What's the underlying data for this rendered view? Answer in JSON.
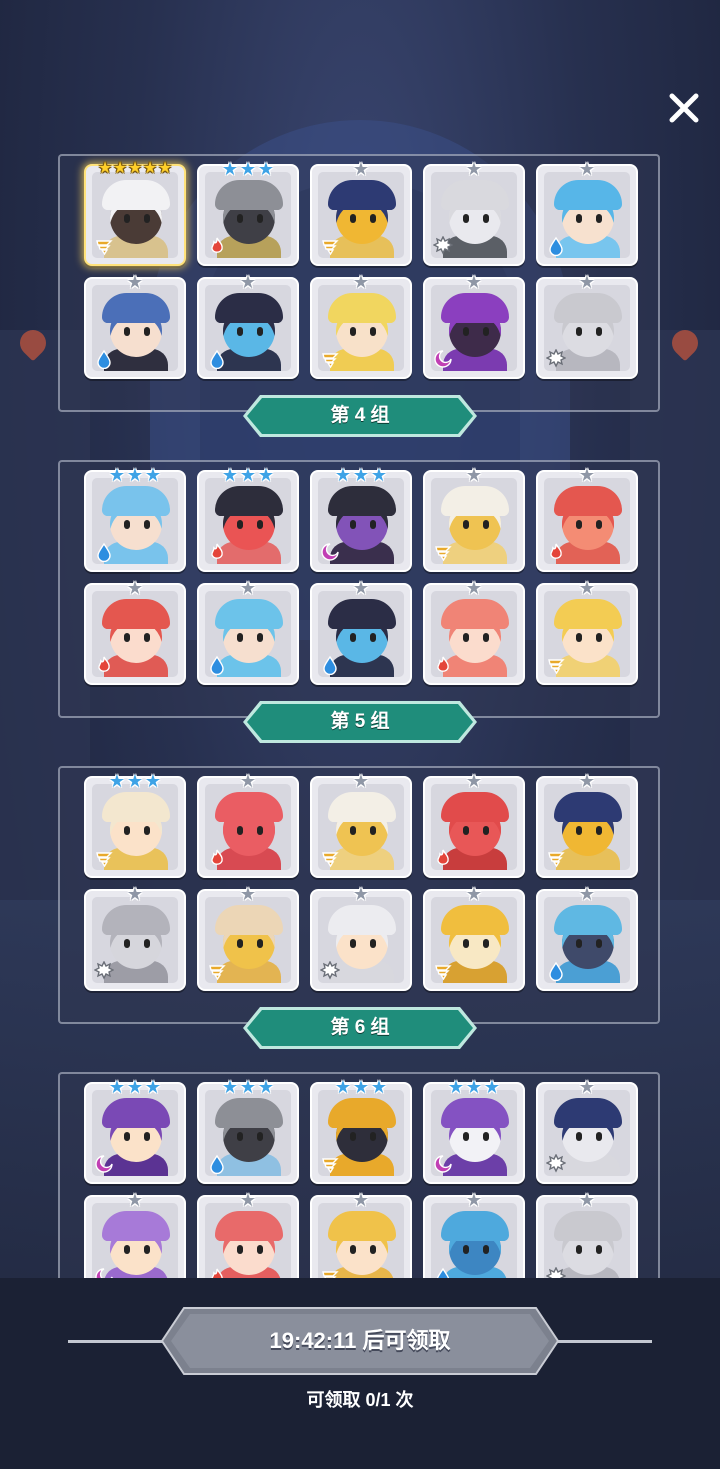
{
  "colors": {
    "banner_fill": "#1f8d7b",
    "banner_border": "#bfe8df",
    "star_grey": "#8f97a6",
    "star_blue": "#3ea3e6",
    "star_gold": "#ffcf2a"
  },
  "groups": [
    {
      "label": "",
      "cards": [
        {
          "stars": 5,
          "star_color": "gold",
          "element": "wind",
          "hair": "#f2f2f4",
          "skin": "#4a3b36",
          "body": "#d8c28e",
          "highlight": true
        },
        {
          "stars": 3,
          "star_color": "blue",
          "element": "fire",
          "hair": "#8d8f96",
          "skin": "#3f3f46",
          "body": "#b7a15b"
        },
        {
          "stars": 1,
          "star_color": "grey",
          "element": "wind",
          "hair": "#2d3a73",
          "skin": "#f0b733",
          "body": "#e7c05a"
        },
        {
          "stars": 1,
          "star_color": "grey",
          "element": "light",
          "hair": "#d9d9de",
          "skin": "#e9e9ee",
          "body": "#5b5f66"
        },
        {
          "stars": 1,
          "star_color": "grey",
          "element": "water",
          "hair": "#57b6e8",
          "skin": "#f7e1cf",
          "body": "#78c5ee"
        },
        {
          "stars": 1,
          "star_color": "grey",
          "element": "water",
          "hair": "#4b6fb8",
          "skin": "#f6dfcf",
          "body": "#2f2f3f"
        },
        {
          "stars": 1,
          "star_color": "grey",
          "element": "water",
          "hair": "#2b2d46",
          "skin": "#5ab7e6",
          "body": "#2d3550"
        },
        {
          "stars": 1,
          "star_color": "grey",
          "element": "wind",
          "hair": "#f1d65f",
          "skin": "#f8e1c9",
          "body": "#f0cc53"
        },
        {
          "stars": 1,
          "star_color": "grey",
          "element": "dark",
          "hair": "#8b3fbf",
          "skin": "#3e2b4a",
          "body": "#7b3bb0"
        },
        {
          "stars": 1,
          "star_color": "grey",
          "element": "light",
          "hair": "#c9c9cf",
          "skin": "#dcdce2",
          "body": "#b7b7bf"
        }
      ]
    },
    {
      "label": "第 4 组",
      "cards": [
        {
          "stars": 3,
          "star_color": "blue",
          "element": "water",
          "hair": "#79c3ec",
          "skin": "#f6dfcf",
          "body": "#79c3ec"
        },
        {
          "stars": 3,
          "star_color": "blue",
          "element": "fire",
          "hair": "#2d2d3b",
          "skin": "#ea5454",
          "body": "#e36c6c"
        },
        {
          "stars": 3,
          "star_color": "blue",
          "element": "dark",
          "hair": "#2d2d3b",
          "skin": "#8253b8",
          "body": "#3a2f4d"
        },
        {
          "stars": 1,
          "star_color": "grey",
          "element": "wind",
          "hair": "#f3efe6",
          "skin": "#efc352",
          "body": "#eed07f"
        },
        {
          "stars": 1,
          "star_color": "grey",
          "element": "fire",
          "hair": "#e4574f",
          "skin": "#f48c74",
          "body": "#e26256"
        },
        {
          "stars": 1,
          "star_color": "grey",
          "element": "fire",
          "hair": "#e4574f",
          "skin": "#fbdccd",
          "body": "#e05b55"
        },
        {
          "stars": 1,
          "star_color": "grey",
          "element": "water",
          "hair": "#6cc3ea",
          "skin": "#f6dfcf",
          "body": "#6cc3ea"
        },
        {
          "stars": 1,
          "star_color": "grey",
          "element": "water",
          "hair": "#2b2d46",
          "skin": "#5ab7e6",
          "body": "#2d3550"
        },
        {
          "stars": 1,
          "star_color": "grey",
          "element": "fire",
          "hair": "#f08476",
          "skin": "#fbdccd",
          "body": "#f08476"
        },
        {
          "stars": 1,
          "star_color": "grey",
          "element": "wind",
          "hair": "#f3cc53",
          "skin": "#fbe2c9",
          "body": "#f0d175"
        }
      ]
    },
    {
      "label": "第 5 组",
      "cards": [
        {
          "stars": 3,
          "star_color": "blue",
          "element": "wind",
          "hair": "#f3e7cf",
          "skin": "#fbe2c9",
          "body": "#e9c25a"
        },
        {
          "stars": 1,
          "star_color": "grey",
          "element": "fire",
          "hair": "#ea5d63",
          "skin": "#ea5d63",
          "body": "#d84a52"
        },
        {
          "stars": 1,
          "star_color": "grey",
          "element": "wind",
          "hair": "#f3efe6",
          "skin": "#efc352",
          "body": "#eed07f"
        },
        {
          "stars": 1,
          "star_color": "grey",
          "element": "fire",
          "hair": "#e14b4b",
          "skin": "#e85757",
          "body": "#c83d3d"
        },
        {
          "stars": 1,
          "star_color": "grey",
          "element": "wind",
          "hair": "#2d3a73",
          "skin": "#f0b733",
          "body": "#e7c05a"
        },
        {
          "stars": 1,
          "star_color": "grey",
          "element": "light",
          "hair": "#b3b3bb",
          "skin": "#d6d6dc",
          "body": "#9d9da6"
        },
        {
          "stars": 1,
          "star_color": "grey",
          "element": "wind",
          "hair": "#ecd6b6",
          "skin": "#f0c24a",
          "body": "#e3b452"
        },
        {
          "stars": 1,
          "star_color": "grey",
          "element": "light",
          "hair": "#ececf0",
          "skin": "#fbe2c9",
          "body": "#d8d8de"
        },
        {
          "stars": 1,
          "star_color": "grey",
          "element": "wind",
          "hair": "#f0be3e",
          "skin": "#f8e8c4",
          "body": "#d8a132"
        },
        {
          "stars": 1,
          "star_color": "grey",
          "element": "water",
          "hair": "#5fb8e3",
          "skin": "#3f4a6a",
          "body": "#4b9fd4"
        }
      ]
    },
    {
      "label": "第 6 组",
      "cards": [
        {
          "stars": 3,
          "star_color": "blue",
          "element": "dark",
          "hair": "#7a49b5",
          "skin": "#fbe2c9",
          "body": "#5b3393"
        },
        {
          "stars": 3,
          "star_color": "blue",
          "element": "water",
          "hair": "#8d8f96",
          "skin": "#3f3f46",
          "body": "#8fc0e2"
        },
        {
          "stars": 3,
          "star_color": "blue",
          "element": "wind",
          "hair": "#e8a92b",
          "skin": "#2e2e3a",
          "body": "#e8a92b"
        },
        {
          "stars": 3,
          "star_color": "blue",
          "element": "dark",
          "hair": "#8452c2",
          "skin": "#f2f2f6",
          "body": "#6c3fa8"
        },
        {
          "stars": 1,
          "star_color": "grey",
          "element": "light",
          "hair": "#2d3a73",
          "skin": "#e9e9ee",
          "body": "#d8d8de"
        },
        {
          "stars": 1,
          "star_color": "grey",
          "element": "dark",
          "hair": "#a77ad8",
          "skin": "#fbe2c9",
          "body": "#9a6acd"
        },
        {
          "stars": 1,
          "star_color": "grey",
          "element": "fire",
          "hair": "#e86a6a",
          "skin": "#fbdccd",
          "body": "#e45f5f"
        },
        {
          "stars": 1,
          "star_color": "grey",
          "element": "wind",
          "hair": "#f0c24a",
          "skin": "#fbe2c9",
          "body": "#e8b64a"
        },
        {
          "stars": 1,
          "star_color": "grey",
          "element": "water",
          "hair": "#4ea9dd",
          "skin": "#3d86c2",
          "body": "#4ea9dd"
        },
        {
          "stars": 1,
          "star_color": "grey",
          "element": "light",
          "hair": "#c9c9cf",
          "skin": "#dcdce2",
          "body": "#b7b7bf"
        }
      ]
    }
  ],
  "footer": {
    "timer_label": "19:42:11 后可领取",
    "claim_count_label": "可领取 0/1 次"
  }
}
